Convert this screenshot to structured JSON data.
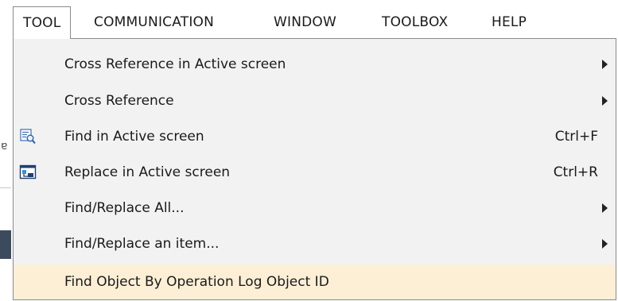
{
  "menubar": {
    "items": [
      {
        "label": "TOOL",
        "active": true
      },
      {
        "label": "COMMUNICATION",
        "active": false
      },
      {
        "label": "WINDOW",
        "active": false
      },
      {
        "label": "TOOLBOX",
        "active": false
      },
      {
        "label": "HELP",
        "active": false
      }
    ]
  },
  "tool_menu": {
    "items": [
      {
        "label": "Cross Reference in Active screen",
        "submenu": true
      },
      {
        "label": "Cross Reference",
        "submenu": true
      },
      {
        "label": "Find in Active screen",
        "shortcut": "Ctrl+F",
        "icon": "find-icon"
      },
      {
        "label": "Replace in Active screen",
        "shortcut": "Ctrl+R",
        "icon": "replace-icon"
      },
      {
        "label": "Find/Replace All...",
        "submenu": true
      },
      {
        "label": "Find/Replace an item...",
        "submenu": true
      },
      {
        "label": "Find Object By Operation Log Object ID",
        "highlighted": true
      }
    ]
  },
  "colors": {
    "highlight": "#fcefd6",
    "menu_background": "#f2f2f2",
    "border": "#8a8a8a"
  }
}
